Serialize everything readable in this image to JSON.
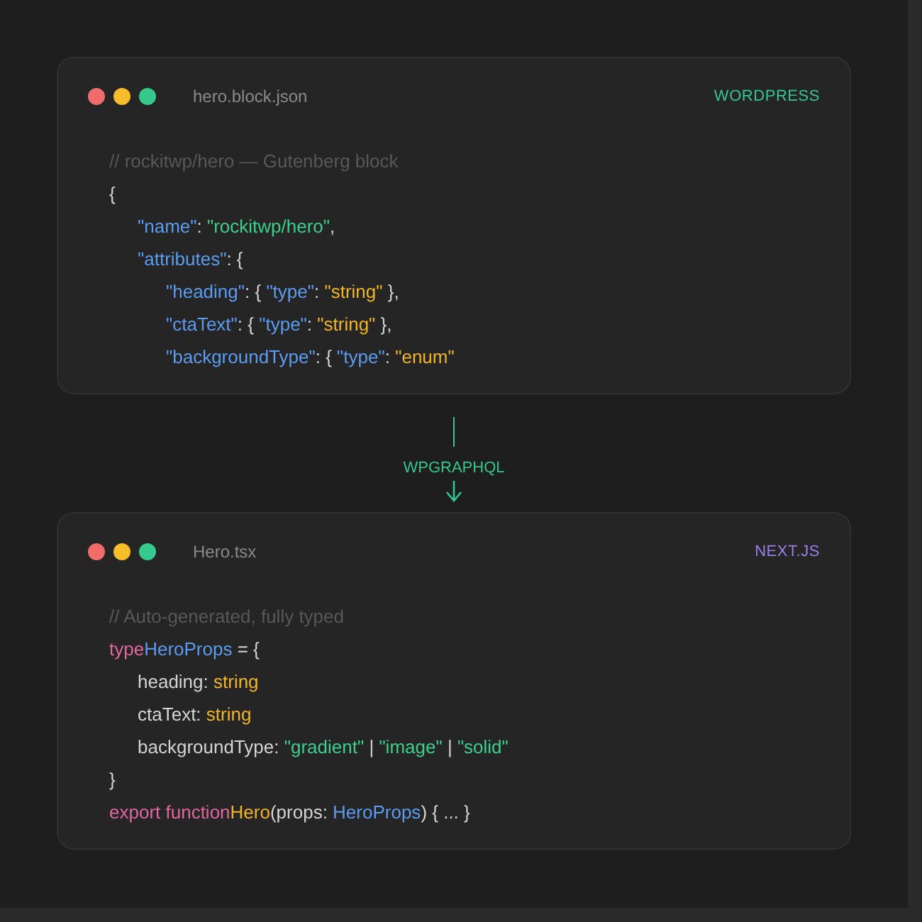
{
  "cards": [
    {
      "filename": "hero.block.json",
      "label": "WORDPRESS",
      "color": "#34c68e",
      "lines": [
        {
          "tokens": [
            {
              "kind": "comment",
              "text": "// rockitwp/hero — Gutenberg block"
            }
          ]
        },
        {
          "tokens": [
            {
              "kind": "plain",
              "text": "{"
            }
          ],
          "children": [
            {
              "tokens": [
                {
                  "kind": "key",
                  "text": "\"name\""
                },
                {
                  "kind": "plain",
                  "text": ": "
                },
                {
                  "kind": "string",
                  "text": "\"rockitwp/hero\""
                },
                {
                  "kind": "plain",
                  "text": ","
                }
              ]
            },
            {
              "tokens": [
                {
                  "kind": "key",
                  "text": "\"attributes\""
                },
                {
                  "kind": "plain",
                  "text": ": {"
                }
              ],
              "children": [
                {
                  "tokens": [
                    {
                      "kind": "key",
                      "text": "\"heading\""
                    },
                    {
                      "kind": "plain",
                      "text": ": { "
                    },
                    {
                      "kind": "key",
                      "text": "\"type\""
                    },
                    {
                      "kind": "plain",
                      "text": ": "
                    },
                    {
                      "kind": "value",
                      "text": "\"string\""
                    },
                    {
                      "kind": "plain",
                      "text": " },"
                    }
                  ]
                },
                {
                  "tokens": [
                    {
                      "kind": "key",
                      "text": "\"ctaText\""
                    },
                    {
                      "kind": "plain",
                      "text": ": { "
                    },
                    {
                      "kind": "key",
                      "text": "\"type\""
                    },
                    {
                      "kind": "plain",
                      "text": ": "
                    },
                    {
                      "kind": "value",
                      "text": "\"string\""
                    },
                    {
                      "kind": "plain",
                      "text": " },"
                    }
                  ]
                },
                {
                  "tokens": [
                    {
                      "kind": "key",
                      "text": "\"backgroundType\""
                    },
                    {
                      "kind": "plain",
                      "text": ": { "
                    },
                    {
                      "kind": "key",
                      "text": "\"type\""
                    },
                    {
                      "kind": "plain",
                      "text": ": "
                    },
                    {
                      "kind": "value",
                      "text": "\"enum\""
                    }
                  ]
                }
              ]
            }
          ]
        }
      ]
    },
    {
      "filename": "Hero.tsx",
      "label": "NEXT.JS",
      "color": "#9b7fe6",
      "lines": [
        {
          "tokens": [
            {
              "kind": "comment",
              "text": "// Auto-generated, fully typed"
            }
          ]
        },
        {
          "tokens": [
            {
              "kind": "keyword",
              "text": "type"
            },
            {
              "kind": "key",
              "text": "HeroProps"
            },
            {
              "kind": "plain",
              "text": " = {"
            }
          ],
          "children": [
            {
              "tokens": [
                {
                  "kind": "plain",
                  "text": "heading: "
                },
                {
                  "kind": "value",
                  "text": "string"
                }
              ]
            },
            {
              "tokens": [
                {
                  "kind": "plain",
                  "text": "ctaText: "
                },
                {
                  "kind": "value",
                  "text": "string"
                }
              ]
            },
            {
              "tokens": [
                {
                  "kind": "plain",
                  "text": "backgroundType: "
                },
                {
                  "kind": "string",
                  "text": "\"gradient\""
                },
                {
                  "kind": "plain",
                  "text": " | "
                },
                {
                  "kind": "string",
                  "text": "\"image\""
                },
                {
                  "kind": "plain",
                  "text": " | "
                },
                {
                  "kind": "string",
                  "text": "\"solid\""
                }
              ]
            }
          ]
        },
        {
          "tokens": [
            {
              "kind": "plain",
              "text": "}"
            }
          ]
        },
        {
          "tokens": [
            {
              "kind": "keyword",
              "text": "export function"
            },
            {
              "kind": "value",
              "text": "Hero"
            },
            {
              "kind": "plain",
              "text": "(props: "
            },
            {
              "kind": "key",
              "text": "HeroProps"
            },
            {
              "kind": "plain",
              "text": ") { ... }"
            }
          ]
        }
      ]
    }
  ],
  "connector": {
    "label": "WPGRAPHQL"
  }
}
